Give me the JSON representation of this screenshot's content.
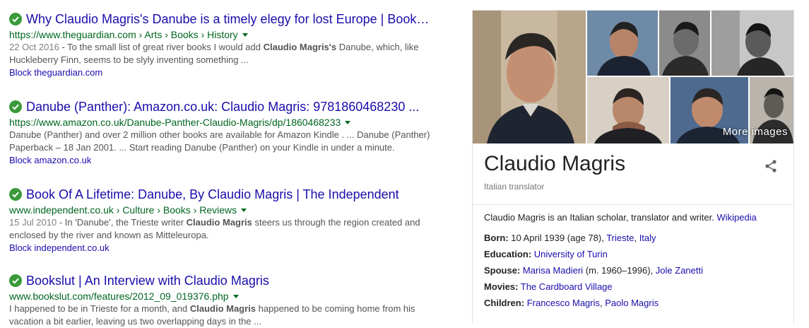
{
  "results": [
    {
      "title": "Why Claudio Magris's Danube is a timely elegy for lost Europe | Book…",
      "url": "https://www.theguardian.com › Arts › Books › History",
      "snippet_date": "22 Oct 2016",
      "snippet_a": " - To the small list of great river books I would add ",
      "snippet_bold": "Claudio Magris's",
      "snippet_b": " Danube, which, like Huckleberry Finn, seems to be slyly inventing something ...",
      "block": "Block theguardian.com"
    },
    {
      "title": "Danube (Panther): Amazon.co.uk: Claudio Magris: 9781860468230 ...",
      "url": "https://www.amazon.co.uk/Danube-Panther-Claudio-Magris/dp/1860468233",
      "snippet_date": "",
      "snippet_a": "Danube (Panther) and over 2 million other books are available for Amazon Kindle . ... Danube (Panther) Paperback – 18 Jan 2001. ... Start reading Danube (Panther) on your Kindle in under a minute.",
      "snippet_bold": "",
      "snippet_b": "",
      "block": "Block amazon.co.uk"
    },
    {
      "title": "Book Of A Lifetime: Danube, By Claudio Magris | The Independent",
      "url": "www.independent.co.uk › Culture › Books › Reviews",
      "snippet_date": "15 Jul 2010",
      "snippet_a": " - In 'Danube', the Trieste writer ",
      "snippet_bold": "Claudio Magris",
      "snippet_b": " steers us through the region created and enclosed by the river and known as Mitteleuropa.",
      "block": "Block independent.co.uk"
    },
    {
      "title": "Bookslut | An Interview with Claudio Magris",
      "url": "www.bookslut.com/features/2012_09_019376.php",
      "snippet_date": "",
      "snippet_a": "I happened to be in Trieste for a month, and ",
      "snippet_bold": "Claudio Magris",
      "snippet_b": " happened to be coming home from his vacation a bit earlier, leaving us two overlapping days in the ...",
      "block": ""
    }
  ],
  "knowledge_panel": {
    "more_images": "More images",
    "name": "Claudio Magris",
    "subtitle": "Italian translator",
    "description": "Claudio Magris is an Italian scholar, translator and writer.",
    "description_link": "Wikipedia",
    "born_label": "Born:",
    "born_text": " 10 April 1939 (age 78), ",
    "born_link1": "Trieste",
    "born_sep": ", ",
    "born_link2": "Italy",
    "education_label": "Education:",
    "education_link": "University of Turin",
    "spouse_label": "Spouse:",
    "spouse_link1": "Marisa Madieri",
    "spouse_text": " (m. 1960–1996), ",
    "spouse_link2": "Jole Zanetti",
    "movies_label": "Movies:",
    "movies_link": "The Cardboard Village",
    "children_label": "Children:",
    "children_link1": "Francesco Magris",
    "children_sep": ", ",
    "children_link2": "Paolo Magris"
  },
  "colors": {
    "link": "#1a0dab",
    "url_green": "#006621",
    "snippet": "#545454",
    "check": "#3a9a3a"
  },
  "icons": [
    "verified-check-icon",
    "dropdown-caret-icon",
    "share-icon"
  ]
}
